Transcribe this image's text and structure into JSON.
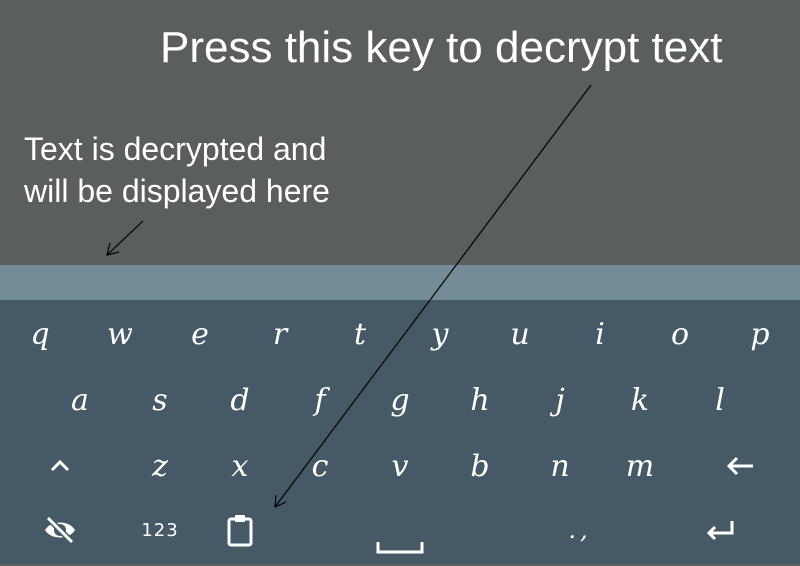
{
  "annotations": {
    "decrypt_key_hint": "Press this key to decrypt text",
    "display_hint_line1": "Text is decrypted and",
    "display_hint_line2": "will be displayed here"
  },
  "keyboard": {
    "row1": [
      "q",
      "w",
      "e",
      "r",
      "t",
      "y",
      "u",
      "i",
      "o",
      "p"
    ],
    "row2": [
      "a",
      "s",
      "d",
      "f",
      "g",
      "h",
      "j",
      "k",
      "l"
    ],
    "row3": [
      "z",
      "x",
      "c",
      "v",
      "b",
      "n",
      "m"
    ],
    "numbers_label": "123",
    "punctuation_label": ".,",
    "icons": {
      "shift": "shift-up-caret-icon",
      "backspace": "backspace-arrow-icon",
      "hide": "eye-slash-icon",
      "decrypt": "clipboard-icon",
      "space": "space-bar-icon",
      "enter": "enter-return-icon"
    }
  },
  "colors": {
    "background": "#5a5f5e",
    "result_bar": "#748c98",
    "keyboard": "#455a66",
    "key_text": "#ffffff"
  }
}
